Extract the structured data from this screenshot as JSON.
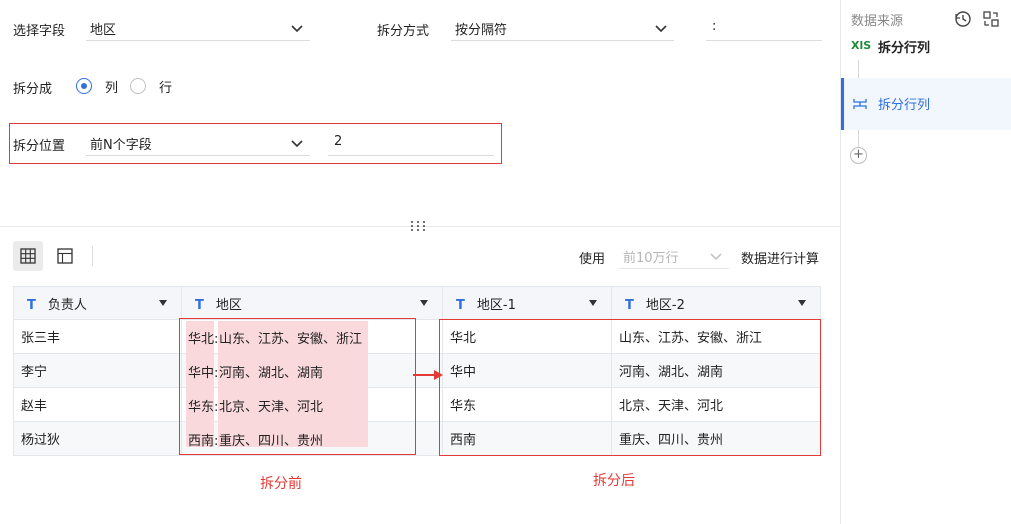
{
  "form": {
    "select_field_label": "选择字段",
    "select_field_value": "地区",
    "split_method_label": "拆分方式",
    "split_method_value": "按分隔符",
    "separator_value": ":",
    "split_into_label": "拆分成",
    "option_column": "列",
    "option_row": "行",
    "option_column_selected": true,
    "split_position_label": "拆分位置",
    "split_position_value": "前N个字段",
    "split_count_value": "2"
  },
  "toolbar": {
    "use_label": "使用",
    "rows_select_value": "前10万行",
    "compute_label": "数据进行计算"
  },
  "table": {
    "columns": [
      "负责人",
      "地区",
      "地区-1",
      "地区-2"
    ],
    "rows": [
      [
        "张三丰",
        "华北:山东、江苏、安徽、浙江",
        "华北",
        "山东、江苏、安徽、浙江"
      ],
      [
        "李宁",
        "华中:河南、湖北、湖南",
        "华中",
        "河南、湖北、湖南"
      ],
      [
        "赵丰",
        "华东:北京、天津、河北",
        "华东",
        "北京、天津、河北"
      ],
      [
        "杨过狄",
        "西南:重庆、四川、贵州",
        "西南",
        "重庆、四川、贵州"
      ]
    ],
    "region_prefix": [
      "华北:",
      "华中:",
      "华东:",
      "西南:"
    ],
    "region_rest": [
      "山东、江苏、安徽、浙江",
      "河南、湖北、湖南",
      "北京、天津、河北",
      "重庆、四川、贵州"
    ]
  },
  "captions": {
    "before": "拆分前",
    "after": "拆分后"
  },
  "right_panel": {
    "title": "数据来源",
    "source_badge": "XlS",
    "source_label": "拆分行列",
    "step_label": "拆分行列"
  },
  "colors": {
    "accent": "#2f6fe0",
    "annotation_red": "#e53935",
    "highlight_pink": "#fad9dc"
  }
}
